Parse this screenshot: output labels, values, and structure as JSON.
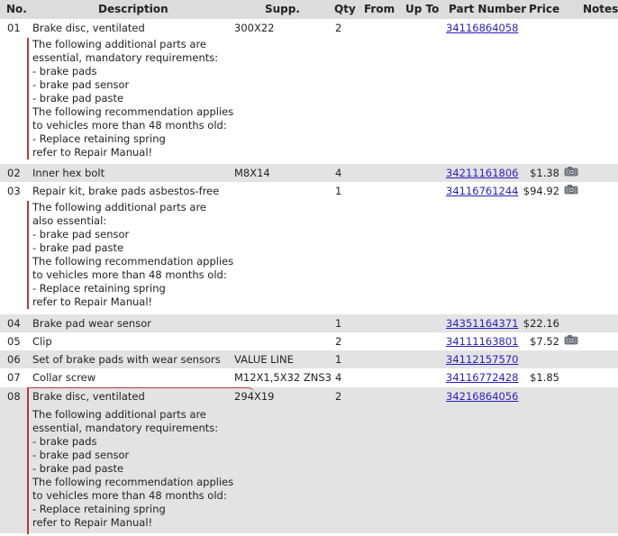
{
  "headers": {
    "no": "No.",
    "description": "Description",
    "supp": "Supp.",
    "qty": "Qty",
    "from": "From",
    "up_to": "Up To",
    "part_number": "Part Number",
    "price": "Price",
    "notes": "Notes"
  },
  "rows": [
    {
      "no": "01",
      "description": "Brake disc, ventilated",
      "supp": "300X22",
      "qty": "2",
      "part_number": "34116864058",
      "price": "",
      "notes": [
        "The following additional parts are",
        "essential, mandatory requirements:",
        "- brake pads",
        "- brake pad sensor",
        "- brake pad paste",
        "The following recommendation applies",
        "to vehicles more than 48 months old:",
        "- Replace retaining spring",
        "refer to Repair Manual!"
      ]
    },
    {
      "no": "02",
      "description": "Inner hex bolt",
      "supp": "M8X14",
      "qty": "4",
      "part_number": "34211161806",
      "price": "$1.38",
      "icon": "camera-icon"
    },
    {
      "no": "03",
      "description": "Repair kit, brake pads asbestos-free",
      "supp": "",
      "qty": "1",
      "part_number": "34116761244",
      "price": "$94.92",
      "icon": "camera-icon",
      "notes": [
        "The following additional parts are",
        "also essential:",
        "- brake pad sensor",
        "- brake pad paste",
        "The following recommendation applies",
        "to vehicles more than 48 months old:",
        "- Replace retaining spring",
        "refer to Repair Manual!"
      ]
    },
    {
      "no": "04",
      "description": "Brake pad wear sensor",
      "supp": "",
      "qty": "1",
      "part_number": "34351164371",
      "price": "$22.16"
    },
    {
      "no": "05",
      "description": "Clip",
      "supp": "",
      "qty": "2",
      "part_number": "34111163801",
      "price": "$7.52",
      "icon": "camera-icon"
    },
    {
      "no": "06",
      "description": "Set of brake pads with wear sensors",
      "supp": "VALUE LINE",
      "qty": "1",
      "part_number": "34112157570",
      "price": ""
    },
    {
      "no": "07",
      "description": "Collar screw",
      "supp": "M12X1,5X32 ZNS3",
      "qty": "4",
      "part_number": "34116772428",
      "price": "$1.85"
    },
    {
      "no": "08",
      "description": "Brake disc, ventilated",
      "supp": "294X19",
      "qty": "2",
      "part_number": "34216864056",
      "price": "",
      "notes": [
        "The following additional parts are",
        "essential, mandatory requirements:",
        "- brake pads",
        "- brake pad sensor",
        "- brake pad paste",
        "The following recommendation applies",
        "to vehicles more than 48 months old:",
        "- Replace retaining spring",
        "refer to Repair Manual!"
      ]
    }
  ],
  "colors": {
    "header_bg": "#dcdcdc",
    "alt_row_bg": "#e3e3e3",
    "link": "#2a1fbf",
    "note_border": "#b23b3b"
  }
}
